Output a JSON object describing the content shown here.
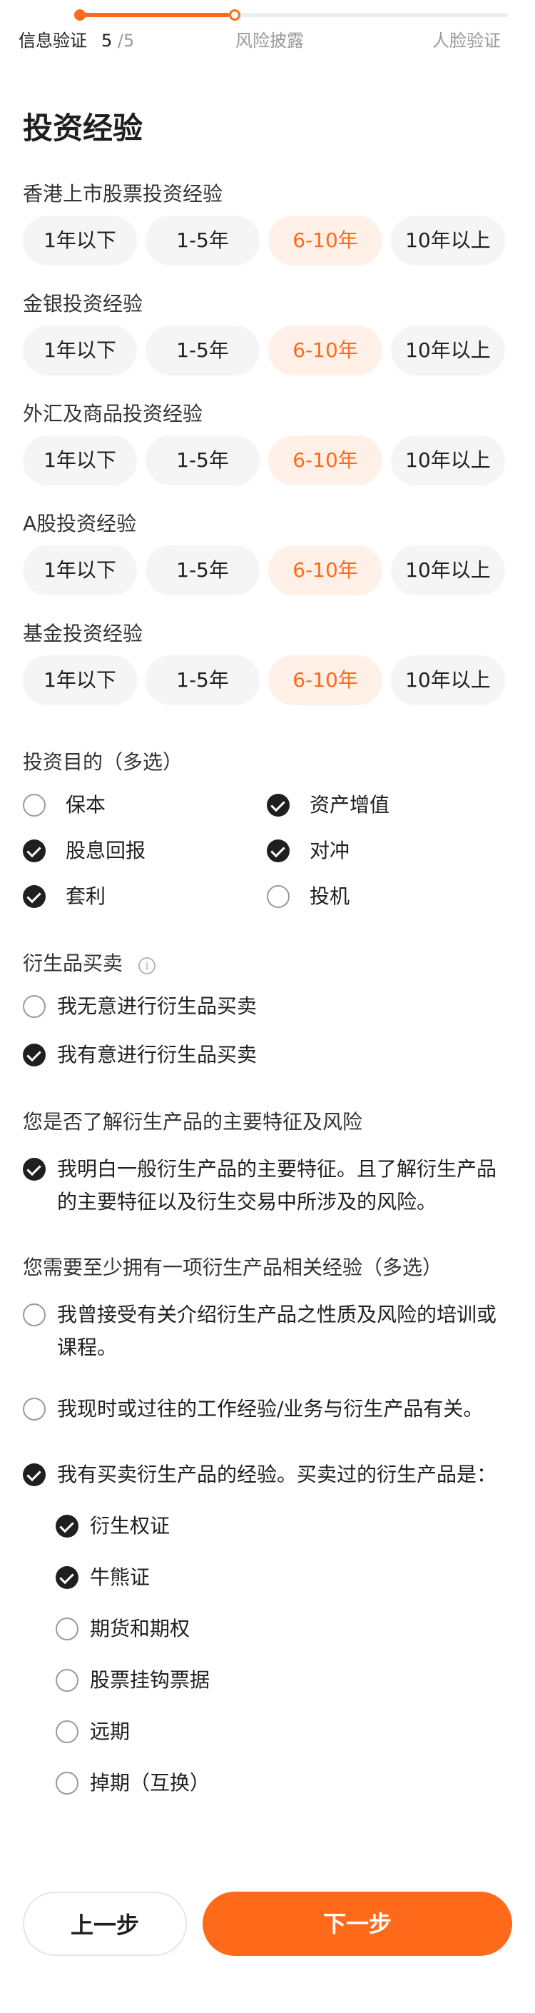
{
  "progress": {
    "steps": [
      "信息验证",
      "风险披露",
      "人脸验证"
    ],
    "current": "5",
    "total": "/5",
    "fraction": 0.35
  },
  "page_title": "投资经验",
  "experience": [
    {
      "label": "香港上市股票投资经验",
      "options": [
        "1年以下",
        "1-5年",
        "6-10年",
        "10年以上"
      ],
      "selected": 2
    },
    {
      "label": "金银投资经验",
      "options": [
        "1年以下",
        "1-5年",
        "6-10年",
        "10年以上"
      ],
      "selected": 2
    },
    {
      "label": "外汇及商品投资经验",
      "options": [
        "1年以下",
        "1-5年",
        "6-10年",
        "10年以上"
      ],
      "selected": 2
    },
    {
      "label": "A股投资经验",
      "options": [
        "1年以下",
        "1-5年",
        "6-10年",
        "10年以上"
      ],
      "selected": 2
    },
    {
      "label": "基金投资经验",
      "options": [
        "1年以下",
        "1-5年",
        "6-10年",
        "10年以上"
      ],
      "selected": 2
    }
  ],
  "purpose": {
    "label": "投资目的（多选）",
    "items": [
      {
        "label": "保本",
        "checked": false
      },
      {
        "label": "资产增值",
        "checked": true
      },
      {
        "label": "股息回报",
        "checked": true
      },
      {
        "label": "对冲",
        "checked": true
      },
      {
        "label": "套利",
        "checked": true
      },
      {
        "label": "投机",
        "checked": false
      }
    ]
  },
  "derivative_trading": {
    "label": "衍生品买卖",
    "items": [
      {
        "label": "我无意进行衍生品买卖",
        "checked": false
      },
      {
        "label": "我有意进行衍生品买卖",
        "checked": true
      }
    ]
  },
  "understanding": {
    "label": "您是否了解衍生产品的主要特征及风险",
    "items": [
      {
        "label": "我明白一般衍生产品的主要特征。且了解衍生产品的主要特征以及衍生交易中所涉及的风险。",
        "checked": true
      }
    ]
  },
  "experience_req": {
    "label": "您需要至少拥有一项衍生产品相关经验（多选）",
    "items": [
      {
        "label": "我曾接受有关介绍衍生产品之性质及风险的培训或课程。",
        "checked": false
      },
      {
        "label": "我现时或过往的工作经验/业务与衍生产品有关。",
        "checked": false
      },
      {
        "label": "我有买卖衍生产品的经验。买卖过的衍生产品是：",
        "checked": true
      }
    ],
    "sub_items": [
      {
        "label": "衍生权证",
        "checked": true
      },
      {
        "label": "牛熊证",
        "checked": true
      },
      {
        "label": "期货和期权",
        "checked": false
      },
      {
        "label": "股票挂钩票据",
        "checked": false
      },
      {
        "label": "远期",
        "checked": false
      },
      {
        "label": "掉期（互换）",
        "checked": false
      }
    ]
  },
  "buttons": {
    "prev": "上一步",
    "next": "下一步"
  },
  "colors": {
    "accent": "#ff6a1a",
    "accent_light": "#fff1e8",
    "check": "#1f1f1f"
  }
}
